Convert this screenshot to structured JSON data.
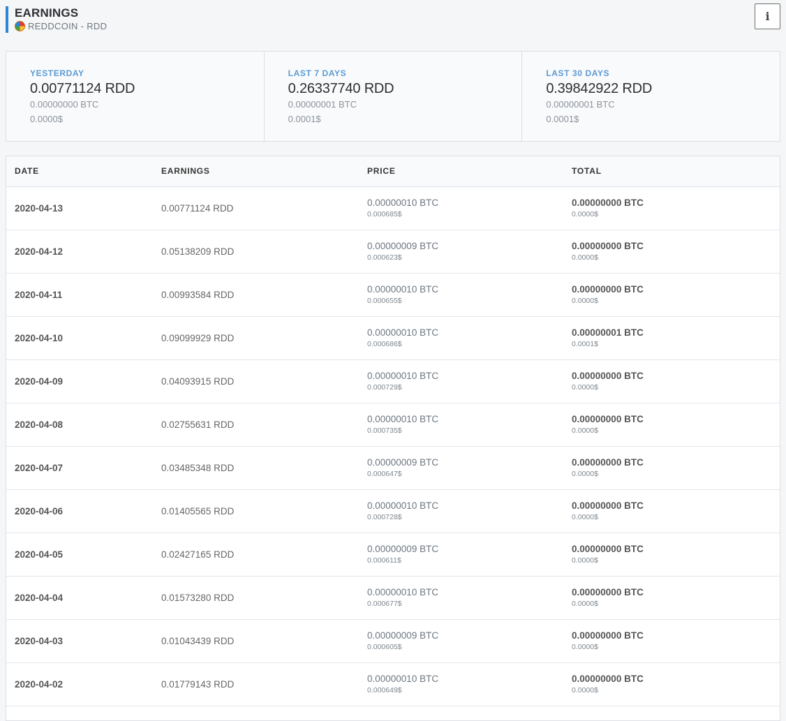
{
  "header": {
    "title": "EARNINGS",
    "subtitle": "REDDCOIN - RDD",
    "coin_icon": "reddcoin-logo-icon",
    "info_label": "i"
  },
  "stats": [
    {
      "label": "YESTERDAY",
      "main": "0.00771124 RDD",
      "btc": "0.00000000 BTC",
      "usd": "0.0000$"
    },
    {
      "label": "LAST 7 DAYS",
      "main": "0.26337740 RDD",
      "btc": "0.00000001 BTC",
      "usd": "0.0001$"
    },
    {
      "label": "LAST 30 DAYS",
      "main": "0.39842922 RDD",
      "btc": "0.00000001 BTC",
      "usd": "0.0001$"
    }
  ],
  "table": {
    "headers": [
      "DATE",
      "EARNINGS",
      "PRICE",
      "TOTAL"
    ],
    "rows": [
      {
        "date": "2020-04-13",
        "earnings": "0.00771124 RDD",
        "price_btc": "0.00000010 BTC",
        "price_usd": "0.000685$",
        "total_btc": "0.00000000 BTC",
        "total_usd": "0.0000$"
      },
      {
        "date": "2020-04-12",
        "earnings": "0.05138209 RDD",
        "price_btc": "0.00000009 BTC",
        "price_usd": "0.000623$",
        "total_btc": "0.00000000 BTC",
        "total_usd": "0.0000$"
      },
      {
        "date": "2020-04-11",
        "earnings": "0.00993584 RDD",
        "price_btc": "0.00000010 BTC",
        "price_usd": "0.000655$",
        "total_btc": "0.00000000 BTC",
        "total_usd": "0.0000$"
      },
      {
        "date": "2020-04-10",
        "earnings": "0.09099929 RDD",
        "price_btc": "0.00000010 BTC",
        "price_usd": "0.000686$",
        "total_btc": "0.00000001 BTC",
        "total_usd": "0.0001$"
      },
      {
        "date": "2020-04-09",
        "earnings": "0.04093915 RDD",
        "price_btc": "0.00000010 BTC",
        "price_usd": "0.000729$",
        "total_btc": "0.00000000 BTC",
        "total_usd": "0.0000$"
      },
      {
        "date": "2020-04-08",
        "earnings": "0.02755631 RDD",
        "price_btc": "0.00000010 BTC",
        "price_usd": "0.000735$",
        "total_btc": "0.00000000 BTC",
        "total_usd": "0.0000$"
      },
      {
        "date": "2020-04-07",
        "earnings": "0.03485348 RDD",
        "price_btc": "0.00000009 BTC",
        "price_usd": "0.000647$",
        "total_btc": "0.00000000 BTC",
        "total_usd": "0.0000$"
      },
      {
        "date": "2020-04-06",
        "earnings": "0.01405565 RDD",
        "price_btc": "0.00000010 BTC",
        "price_usd": "0.000728$",
        "total_btc": "0.00000000 BTC",
        "total_usd": "0.0000$"
      },
      {
        "date": "2020-04-05",
        "earnings": "0.02427165 RDD",
        "price_btc": "0.00000009 BTC",
        "price_usd": "0.000611$",
        "total_btc": "0.00000000 BTC",
        "total_usd": "0.0000$"
      },
      {
        "date": "2020-04-04",
        "earnings": "0.01573280 RDD",
        "price_btc": "0.00000010 BTC",
        "price_usd": "0.000677$",
        "total_btc": "0.00000000 BTC",
        "total_usd": "0.0000$"
      },
      {
        "date": "2020-04-03",
        "earnings": "0.01043439 RDD",
        "price_btc": "0.00000009 BTC",
        "price_usd": "0.000605$",
        "total_btc": "0.00000000 BTC",
        "total_usd": "0.0000$"
      },
      {
        "date": "2020-04-02",
        "earnings": "0.01779143 RDD",
        "price_btc": "0.00000010 BTC",
        "price_usd": "0.000649$",
        "total_btc": "0.00000000 BTC",
        "total_usd": "0.0000$"
      }
    ]
  },
  "colors": {
    "accent": "#2b86d6",
    "stat_label": "#5b9bd5"
  }
}
